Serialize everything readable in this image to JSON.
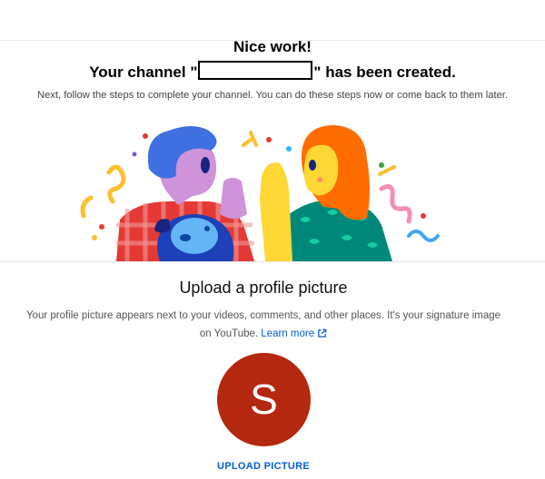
{
  "header": {
    "title": "Nice work!",
    "channel_prefix": "Your channel \"",
    "channel_suffix": "\" has been created.",
    "subtitle": "Next, follow the steps to complete your channel. You can do these steps now or come back to them later."
  },
  "profile_section": {
    "title": "Upload a profile picture",
    "description": "Your profile picture appears next to your videos, comments, and other places. It's your signature image on YouTube.",
    "learn_more": "Learn more",
    "avatar_letter": "S",
    "avatar_color": "#b3280e",
    "upload_button": "UPLOAD PICTURE"
  },
  "colors": {
    "link": "#065fd4"
  }
}
